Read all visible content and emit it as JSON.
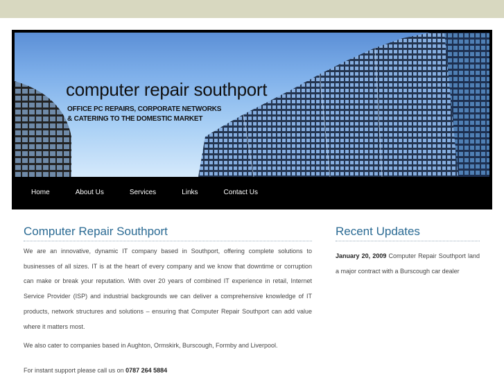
{
  "header": {
    "site_title": "computer repair southport",
    "tagline_line1": "OFFICE PC REPAIRS, CORPORATE NETWORKS",
    "tagline_line2": "& CATERING TO THE DOMESTIC MARKET"
  },
  "nav": {
    "items": [
      {
        "label": "Home"
      },
      {
        "label": "About Us"
      },
      {
        "label": "Services"
      },
      {
        "label": "Links"
      },
      {
        "label": "Contact Us"
      }
    ]
  },
  "main": {
    "heading": "Computer Repair Southport",
    "paragraph1": "We are an innovative, dynamic IT company based in Southport, offering complete solutions to businesses of all sizes. IT is at the heart of every company and we know that downtime or corruption can make or break your reputation. With over 20 years of combined IT experience in retail, Internet Service Provider (ISP) and industrial backgrounds we can deliver a comprehensive knowledge of IT products, network structures and solutions – ensuring that Computer Repair Southport can add value where it matters most.",
    "paragraph2": "We also cater to companies based in Aughton, Ormskirk, Burscough, Formby and Liverpool.",
    "support_prefix": "For instant support please call us on",
    "support_phone": "0787 264 5884"
  },
  "sidebar": {
    "heading": "Recent Updates",
    "update_date": "January 20, 2009",
    "update_text": "Computer Repair Southport land a major contract with a Burscough car dealer"
  },
  "colors": {
    "top_bar": "#d8d8c0",
    "heading": "#2a6a93",
    "nav_background": "#000000"
  }
}
